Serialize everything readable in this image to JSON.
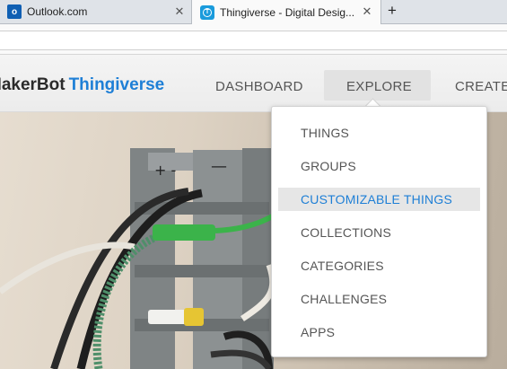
{
  "browser": {
    "tabs": [
      {
        "title": "Outlook.com",
        "icon": "outlook-icon"
      },
      {
        "title": "Thingiverse - Digital Desig...",
        "icon": "thingiverse-icon",
        "active": true
      }
    ],
    "close_glyph": "✕",
    "new_tab_glyph": "+"
  },
  "site": {
    "logo_prefix": "MakerBot",
    "logo_name": "Thingiverse",
    "nav": [
      {
        "label": "DASHBOARD"
      },
      {
        "label": "EXPLORE",
        "active": true
      },
      {
        "label": "CREATE"
      }
    ]
  },
  "explore_menu": {
    "items": [
      {
        "label": "THINGS"
      },
      {
        "label": "GROUPS"
      },
      {
        "label": "CUSTOMIZABLE THINGS",
        "highlighted": true
      },
      {
        "label": "COLLECTIONS"
      },
      {
        "label": "CATEGORIES"
      },
      {
        "label": "CHALLENGES"
      },
      {
        "label": "APPS"
      }
    ]
  },
  "colors": {
    "accent": "#1e7fd6",
    "menu_highlight_bg": "#e6e6e6"
  }
}
